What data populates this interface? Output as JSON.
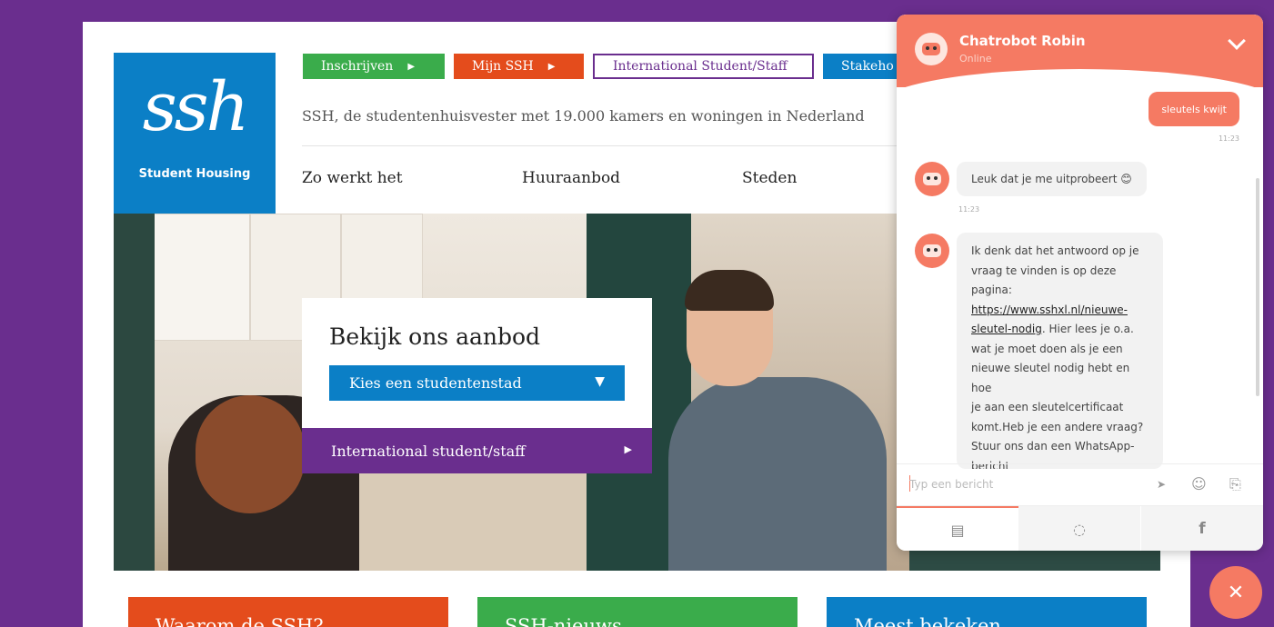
{
  "brand": {
    "logo_mark": "ssh",
    "logo_sub": "Student Housing",
    "colors": {
      "purple": "#6a2e8e",
      "blue": "#0b7fc6",
      "green": "#3aac4b",
      "orange": "#e44c1c",
      "coral": "#f57a63"
    }
  },
  "top_buttons": [
    {
      "label": "Inschrijven",
      "icon": "play-arrow-icon"
    },
    {
      "label": "Mijn SSH",
      "icon": "play-arrow-icon"
    },
    {
      "label": "International Student/Staff"
    },
    {
      "label": "Stakeho"
    }
  ],
  "tagline": "SSH, de studentenhuisvester met 19.000 kamers en woningen in Nederland",
  "nav": [
    "Zo werkt het",
    "Huuraanbod",
    "Steden"
  ],
  "search": {
    "title": "Bekijk ons aanbod",
    "select_label": "Kies een studentenstad",
    "international_label": "International student/staff"
  },
  "tiles": [
    "Waarom de SSH?",
    "SSH-nieuws",
    "Meest bekeken"
  ],
  "chat": {
    "name": "Chatrobot Robin",
    "status": "Online",
    "messages": {
      "user_1": "sleutels kwijt",
      "user_1_time": "11:23",
      "bot_1": "Leuk dat je me uitprobeert 😊",
      "bot_1_time": "11:23",
      "bot_2_lines": [
        "Ik denk dat het antwoord op je",
        "vraag te vinden is op deze",
        "pagina:"
      ],
      "bot_2_link": "https://www.sshxl.nl/nieuwe-sleutel-nodig",
      "bot_2_rest_lines": [
        ". Hier lees je o.a.",
        "wat je moet doen als je een",
        "nieuwe sleutel nodig hebt en hoe",
        "je aan een sleutelcertificaat",
        "komt.Heb je een andere vraag?",
        "Stuur ons dan een WhatsApp-",
        "bericht"
      ]
    },
    "input_placeholder": "Typ een bericht",
    "icons": {
      "send": "send-icon",
      "emoji": "emoji-icon",
      "attach": "paperclip-icon",
      "tab_chat": "chat-bubble-icon",
      "tab_whatsapp": "whatsapp-icon",
      "tab_facebook": "facebook-icon",
      "close": "close-icon"
    },
    "glyphs": {
      "send": "➤",
      "emoji": "☺",
      "attach": "⎘",
      "chat": "▤",
      "whatsapp": "◌",
      "facebook": "f",
      "close": "✕",
      "arrow": "▶",
      "caret": "▼"
    }
  }
}
